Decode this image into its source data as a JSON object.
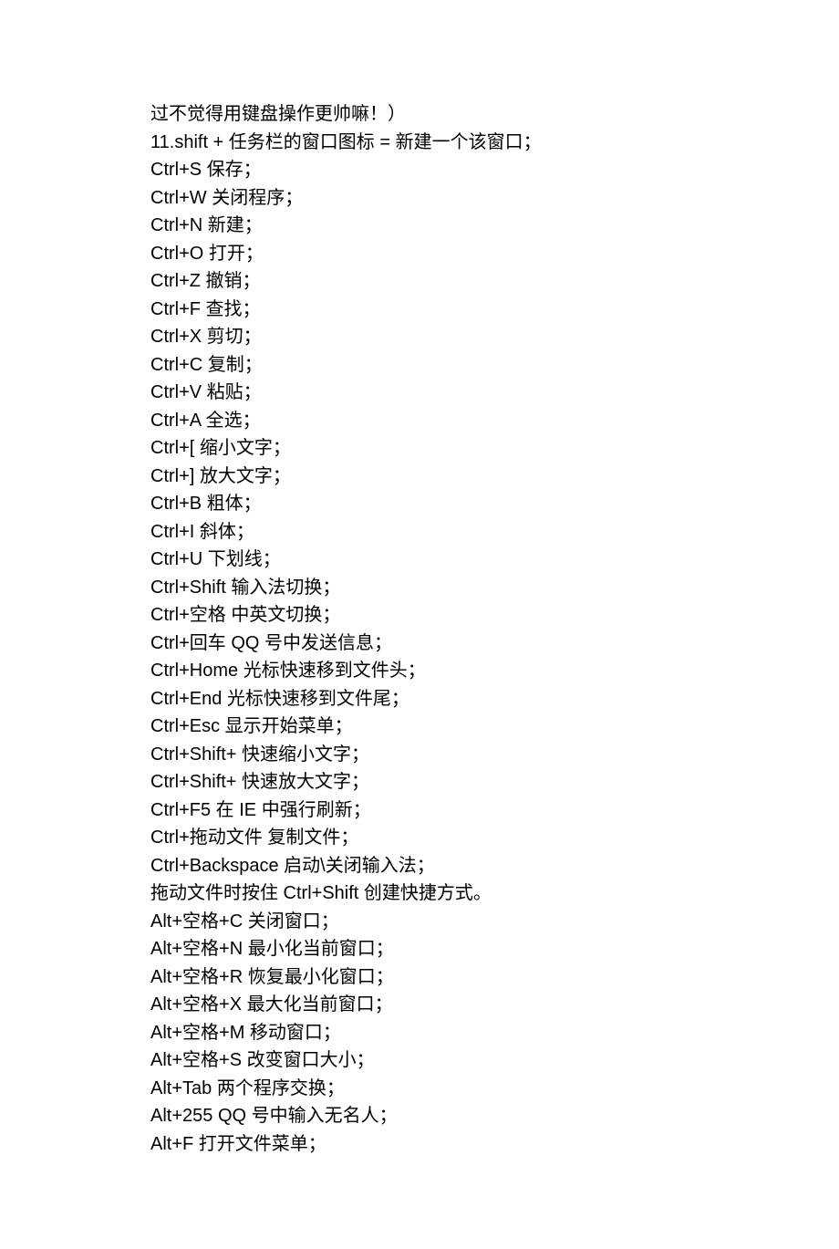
{
  "lines": [
    "过不觉得用键盘操作更帅嘛！）",
    "11.shift + 任务栏的窗口图标 = 新建一个该窗口；",
    "Ctrl+S 保存；",
    "Ctrl+W 关闭程序；",
    "Ctrl+N 新建；",
    "Ctrl+O 打开；",
    "Ctrl+Z 撤销；",
    "Ctrl+F 查找；",
    "Ctrl+X 剪切；",
    "Ctrl+C 复制；",
    "Ctrl+V 粘贴；",
    "Ctrl+A 全选；",
    "Ctrl+[ 缩小文字；",
    "Ctrl+] 放大文字；",
    "Ctrl+B 粗体；",
    "Ctrl+I 斜体；",
    "Ctrl+U 下划线；",
    "Ctrl+Shift 输入法切换；",
    "Ctrl+空格 中英文切换；",
    "Ctrl+回车 QQ 号中发送信息；",
    "Ctrl+Home 光标快速移到文件头；",
    "Ctrl+End 光标快速移到文件尾；",
    "Ctrl+Esc 显示开始菜单；",
    "Ctrl+Shift+ 快速缩小文字；",
    "Ctrl+Shift+ 快速放大文字；",
    "Ctrl+F5 在 IE 中强行刷新；",
    "Ctrl+拖动文件 复制文件；",
    "Ctrl+Backspace 启动\\关闭输入法；",
    "拖动文件时按住 Ctrl+Shift 创建快捷方式。",
    "Alt+空格+C 关闭窗口；",
    "Alt+空格+N 最小化当前窗口；",
    "Alt+空格+R 恢复最小化窗口；",
    "Alt+空格+X 最大化当前窗口；",
    "Alt+空格+M 移动窗口；",
    "Alt+空格+S 改变窗口大小；",
    "Alt+Tab 两个程序交换；",
    "Alt+255 QQ 号中输入无名人；",
    "Alt+F 打开文件菜单；"
  ]
}
